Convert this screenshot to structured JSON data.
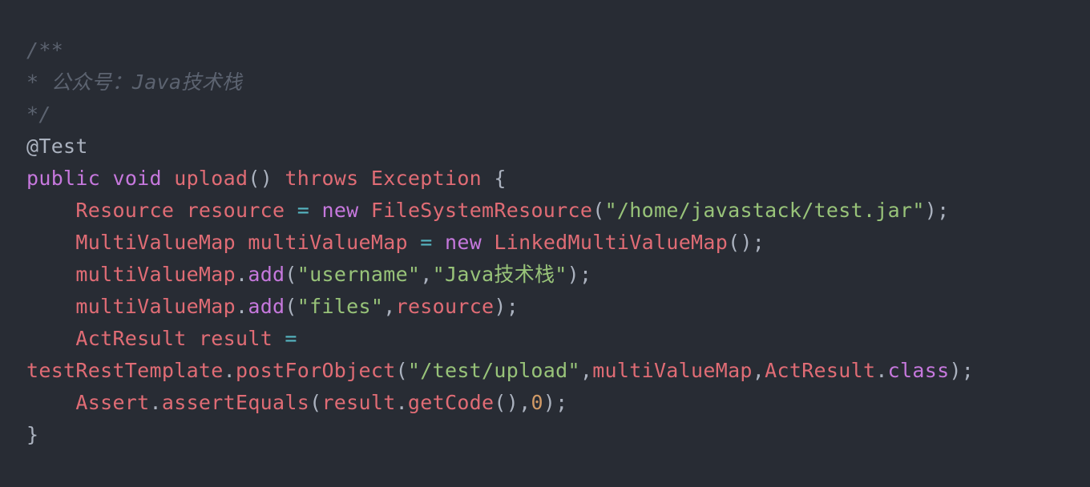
{
  "code": {
    "language": "java",
    "lines": [
      [
        {
          "t": "/**",
          "k": "comment"
        }
      ],
      [
        {
          "t": "* 公众号：Java技术栈",
          "k": "comment"
        }
      ],
      [
        {
          "t": "*/",
          "k": "comment"
        }
      ],
      [
        {
          "t": "@Test",
          "k": "plain"
        }
      ],
      [
        {
          "t": "public",
          "k": "keyword"
        },
        {
          "t": " ",
          "k": "plain"
        },
        {
          "t": "void",
          "k": "keyword"
        },
        {
          "t": " ",
          "k": "plain"
        },
        {
          "t": "upload",
          "k": "builtin"
        },
        {
          "t": "()",
          "k": "punct"
        },
        {
          "t": " ",
          "k": "plain"
        },
        {
          "t": "throws",
          "k": "builtin"
        },
        {
          "t": " ",
          "k": "plain"
        },
        {
          "t": "Exception",
          "k": "builtin"
        },
        {
          "t": " {",
          "k": "punct"
        }
      ],
      [
        {
          "t": "    ",
          "k": "plain"
        },
        {
          "t": "Resource",
          "k": "builtin"
        },
        {
          "t": " ",
          "k": "plain"
        },
        {
          "t": "resource",
          "k": "builtin"
        },
        {
          "t": " ",
          "k": "plain"
        },
        {
          "t": "=",
          "k": "operator"
        },
        {
          "t": " ",
          "k": "plain"
        },
        {
          "t": "new",
          "k": "keyword"
        },
        {
          "t": " ",
          "k": "plain"
        },
        {
          "t": "FileSystemResource",
          "k": "builtin"
        },
        {
          "t": "(",
          "k": "punct"
        },
        {
          "t": "\"/home/javastack/test.jar\"",
          "k": "string"
        },
        {
          "t": ");",
          "k": "punct"
        }
      ],
      [
        {
          "t": "    ",
          "k": "plain"
        },
        {
          "t": "MultiValueMap",
          "k": "builtin"
        },
        {
          "t": " ",
          "k": "plain"
        },
        {
          "t": "multiValueMap",
          "k": "builtin"
        },
        {
          "t": " ",
          "k": "plain"
        },
        {
          "t": "=",
          "k": "operator"
        },
        {
          "t": " ",
          "k": "plain"
        },
        {
          "t": "new",
          "k": "keyword"
        },
        {
          "t": " ",
          "k": "plain"
        },
        {
          "t": "LinkedMultiValueMap",
          "k": "builtin"
        },
        {
          "t": "();",
          "k": "punct"
        }
      ],
      [
        {
          "t": "    ",
          "k": "plain"
        },
        {
          "t": "multiValueMap",
          "k": "builtin"
        },
        {
          "t": ".",
          "k": "punct"
        },
        {
          "t": "add",
          "k": "keyword"
        },
        {
          "t": "(",
          "k": "punct"
        },
        {
          "t": "\"username\"",
          "k": "string"
        },
        {
          "t": ",",
          "k": "punct"
        },
        {
          "t": "\"Java技术栈\"",
          "k": "string"
        },
        {
          "t": ");",
          "k": "punct"
        }
      ],
      [
        {
          "t": "    ",
          "k": "plain"
        },
        {
          "t": "multiValueMap",
          "k": "builtin"
        },
        {
          "t": ".",
          "k": "punct"
        },
        {
          "t": "add",
          "k": "keyword"
        },
        {
          "t": "(",
          "k": "punct"
        },
        {
          "t": "\"files\"",
          "k": "string"
        },
        {
          "t": ",",
          "k": "punct"
        },
        {
          "t": "resource",
          "k": "builtin"
        },
        {
          "t": ");",
          "k": "punct"
        }
      ],
      [
        {
          "t": "    ",
          "k": "plain"
        },
        {
          "t": "ActResult",
          "k": "builtin"
        },
        {
          "t": " ",
          "k": "plain"
        },
        {
          "t": "result",
          "k": "builtin"
        },
        {
          "t": " ",
          "k": "plain"
        },
        {
          "t": "=",
          "k": "operator"
        }
      ],
      [
        {
          "t": "testRestTemplate",
          "k": "builtin"
        },
        {
          "t": ".",
          "k": "punct"
        },
        {
          "t": "postForObject",
          "k": "builtin"
        },
        {
          "t": "(",
          "k": "punct"
        },
        {
          "t": "\"/test/upload\"",
          "k": "string"
        },
        {
          "t": ",",
          "k": "punct"
        },
        {
          "t": "multiValueMap",
          "k": "builtin"
        },
        {
          "t": ",",
          "k": "punct"
        },
        {
          "t": "ActResult",
          "k": "builtin"
        },
        {
          "t": ".",
          "k": "punct"
        },
        {
          "t": "class",
          "k": "keyword"
        },
        {
          "t": ");",
          "k": "punct"
        }
      ],
      [
        {
          "t": "    ",
          "k": "plain"
        },
        {
          "t": "Assert",
          "k": "builtin"
        },
        {
          "t": ".",
          "k": "punct"
        },
        {
          "t": "assertEquals",
          "k": "builtin"
        },
        {
          "t": "(",
          "k": "punct"
        },
        {
          "t": "result",
          "k": "builtin"
        },
        {
          "t": ".",
          "k": "punct"
        },
        {
          "t": "getCode",
          "k": "builtin"
        },
        {
          "t": "(),",
          "k": "punct"
        },
        {
          "t": "0",
          "k": "number"
        },
        {
          "t": ");",
          "k": "punct"
        }
      ],
      [
        {
          "t": "}",
          "k": "punct"
        }
      ]
    ]
  },
  "colors": {
    "background": "#282c34",
    "comment": "#5c6370",
    "keyword": "#c678dd",
    "builtin": "#e06c75",
    "string": "#98c379",
    "number": "#d19a66",
    "operator": "#56b6c2",
    "plain": "#abb2bf"
  }
}
